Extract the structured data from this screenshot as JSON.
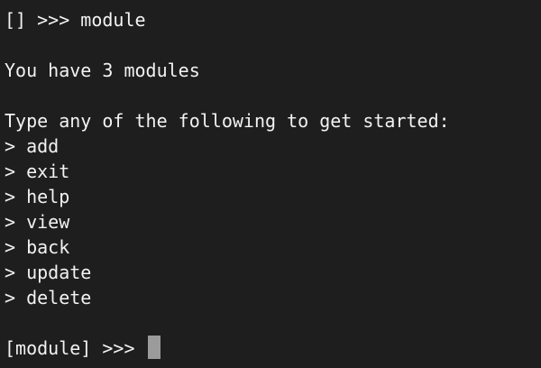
{
  "terminal": {
    "first_prompt": "[] >>> module",
    "summary": "You have 3 modules",
    "instructions": "Type any of the following to get started:",
    "commands": [
      "> add",
      "> exit",
      "> help",
      "> view",
      "> back",
      "> update",
      "> delete"
    ],
    "current_prompt": "[module] >>> "
  },
  "colors": {
    "background": "#1e1e1e",
    "text": "#f2f2f2",
    "cursor": "#9b9b9b"
  },
  "icons": {
    "cursor": "block-cursor"
  }
}
